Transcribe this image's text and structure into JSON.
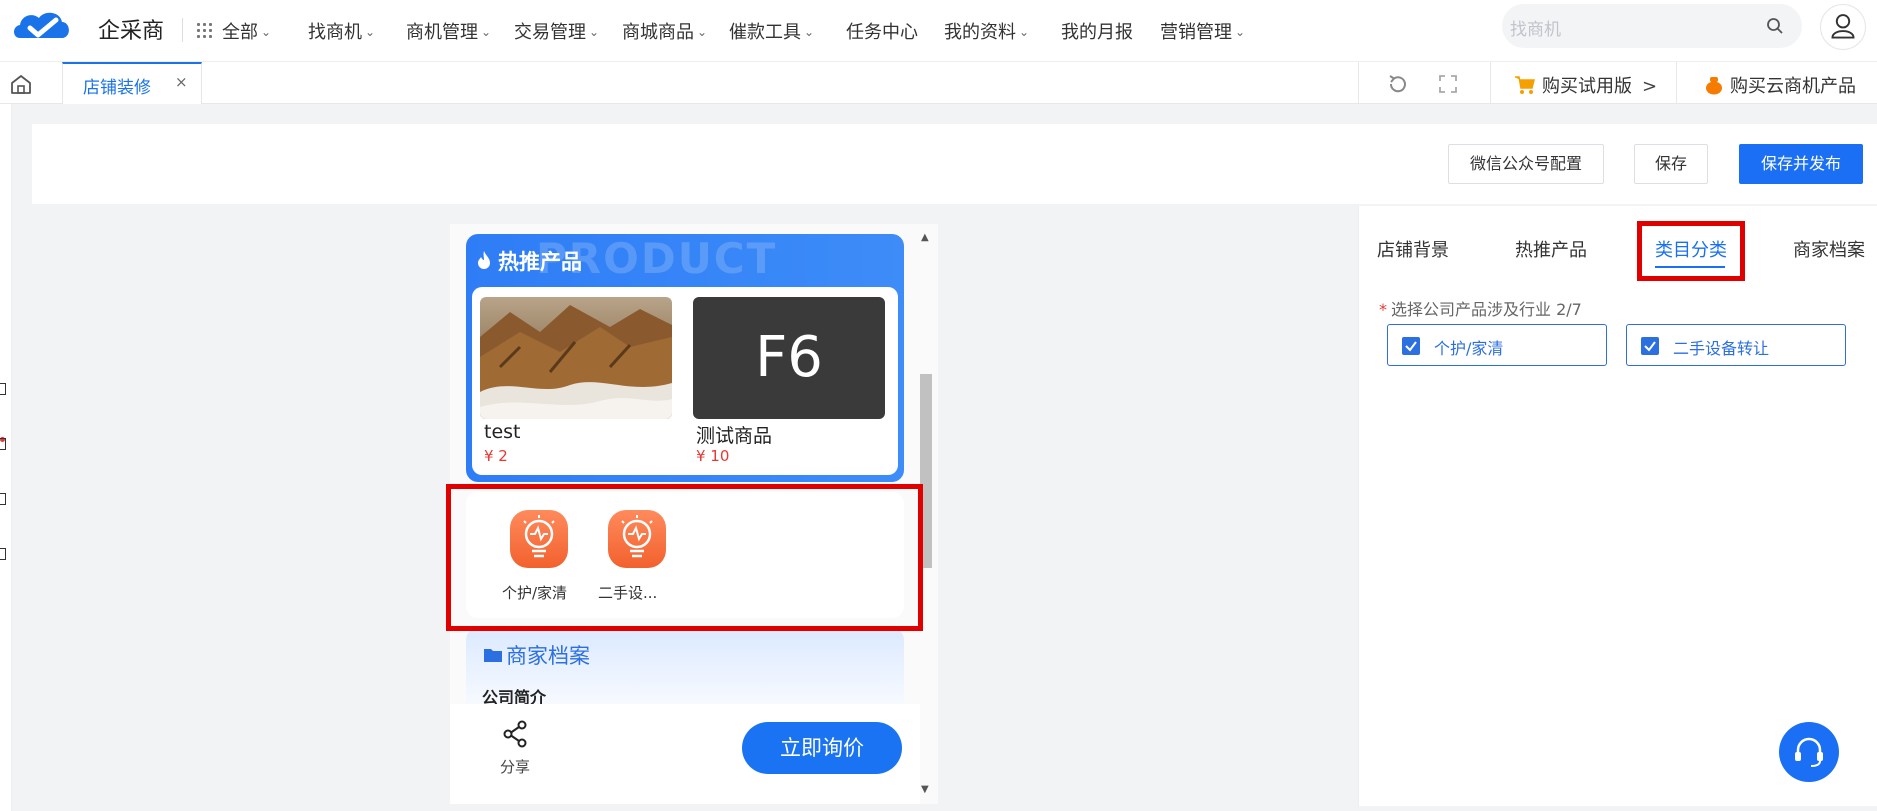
{
  "app": {
    "brand": "企采商"
  },
  "nav": {
    "all": "全部",
    "items": [
      "找商机",
      "商机管理",
      "交易管理",
      "商城商品",
      "催款工具",
      "任务中心",
      "我的资料",
      "我的月报",
      "营销管理"
    ],
    "chevron": "⌄"
  },
  "search": {
    "placeholder": "找商机"
  },
  "tabs": {
    "active_label": "店铺装修",
    "close": "×"
  },
  "promos": {
    "trial": "购买试用版",
    "cloud": "购买云商机产品",
    "chevron": ">"
  },
  "actions": {
    "wechat_config": "微信公众号配置",
    "save": "保存",
    "save_publish": "保存并发布"
  },
  "preview": {
    "hot": {
      "watermark": "PRODUCT",
      "title": "热推产品"
    },
    "products": [
      {
        "name": "test",
        "price": "¥  2"
      },
      {
        "name": "测试商品",
        "price": "¥  10",
        "image_text": "F6"
      }
    ],
    "categories": [
      "个护/家清",
      "二手设..."
    ],
    "archive": {
      "title": "商家档案",
      "subtitle": "公司简介"
    },
    "share_label": "分享",
    "inquire_label": "立即询价"
  },
  "panel": {
    "tabs": [
      "店铺背景",
      "热推产品",
      "类目分类",
      "商家档案"
    ],
    "active_tab": "类目分类",
    "required_mark": "*",
    "required_label": "选择公司产品涉及行业 2/7",
    "options": [
      "个护/家清",
      "二手设备转让"
    ]
  },
  "icons": {
    "logo": "cloud-check-logo",
    "grid": "grid-icon",
    "search": "search-icon",
    "user": "user-icon",
    "home": "home-icon",
    "refresh": "refresh-icon",
    "expand": "expand-icon",
    "cart": "cart-icon",
    "bag": "bag-icon",
    "flame": "flame-icon",
    "category": "bulb-icon",
    "folder": "folder-icon",
    "share": "share-icon",
    "help": "headset-icon"
  },
  "colors": {
    "accent": "#1a6ff5",
    "highlight": "#e10000",
    "price": "#e53935",
    "category_icon": "#f2612e"
  }
}
